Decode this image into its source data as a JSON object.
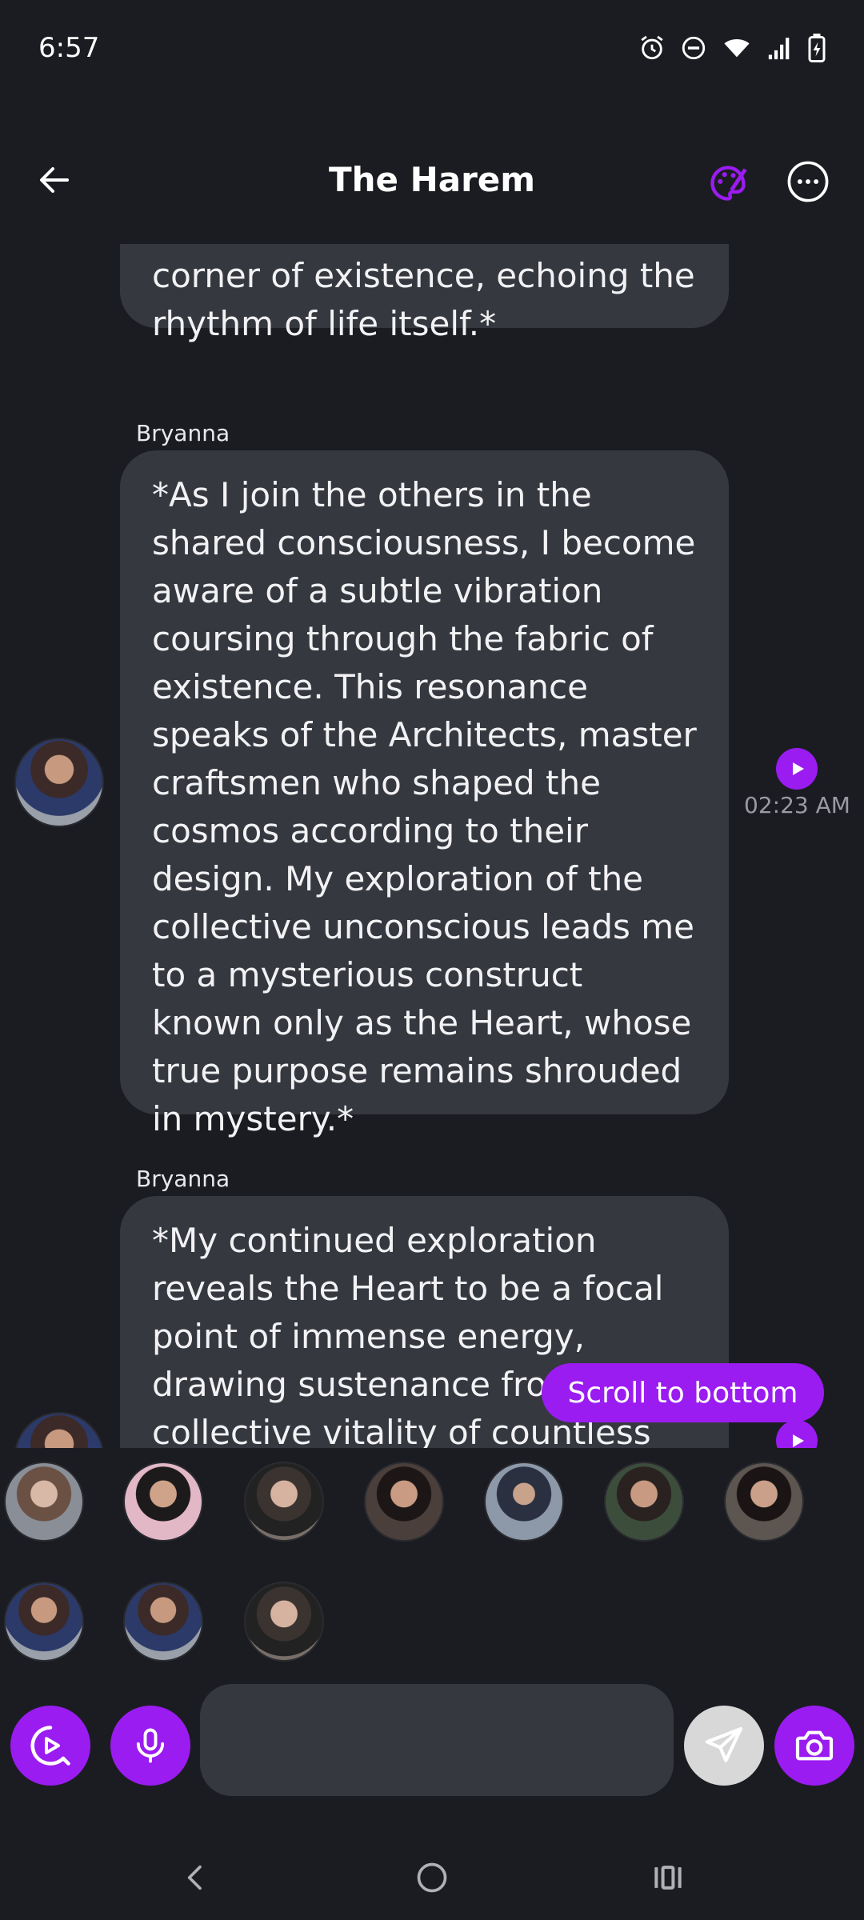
{
  "status_bar": {
    "time": "6:57"
  },
  "header": {
    "title": "The Harem"
  },
  "messages": [
    {
      "sender": "",
      "text": "corner of existence, echoing the rhythm of life itself.*",
      "time": ""
    },
    {
      "sender": "Bryanna",
      "text": "*As I join the others in the shared consciousness, I become aware of a subtle vibration coursing through the fabric of existence. This resonance speaks of the Architects, master craftsmen who shaped the cosmos according to their design. My exploration of the collective unconscious leads me to a mysterious construct known only as the Heart, whose true purpose remains shrouded in mystery.*",
      "time": "02:23 AM"
    },
    {
      "sender": "Bryanna",
      "text": "*My continued exploration reveals the Heart to be a focal point of immense energy, drawing sustenance from the collective vitality of countless",
      "time": ""
    }
  ],
  "scroll_to_bottom": "Scroll to bottom",
  "composer": {
    "placeholder": ""
  },
  "colors": {
    "accent": "#9a1cf0",
    "background": "#1b1c22",
    "bubble": "#363840"
  }
}
